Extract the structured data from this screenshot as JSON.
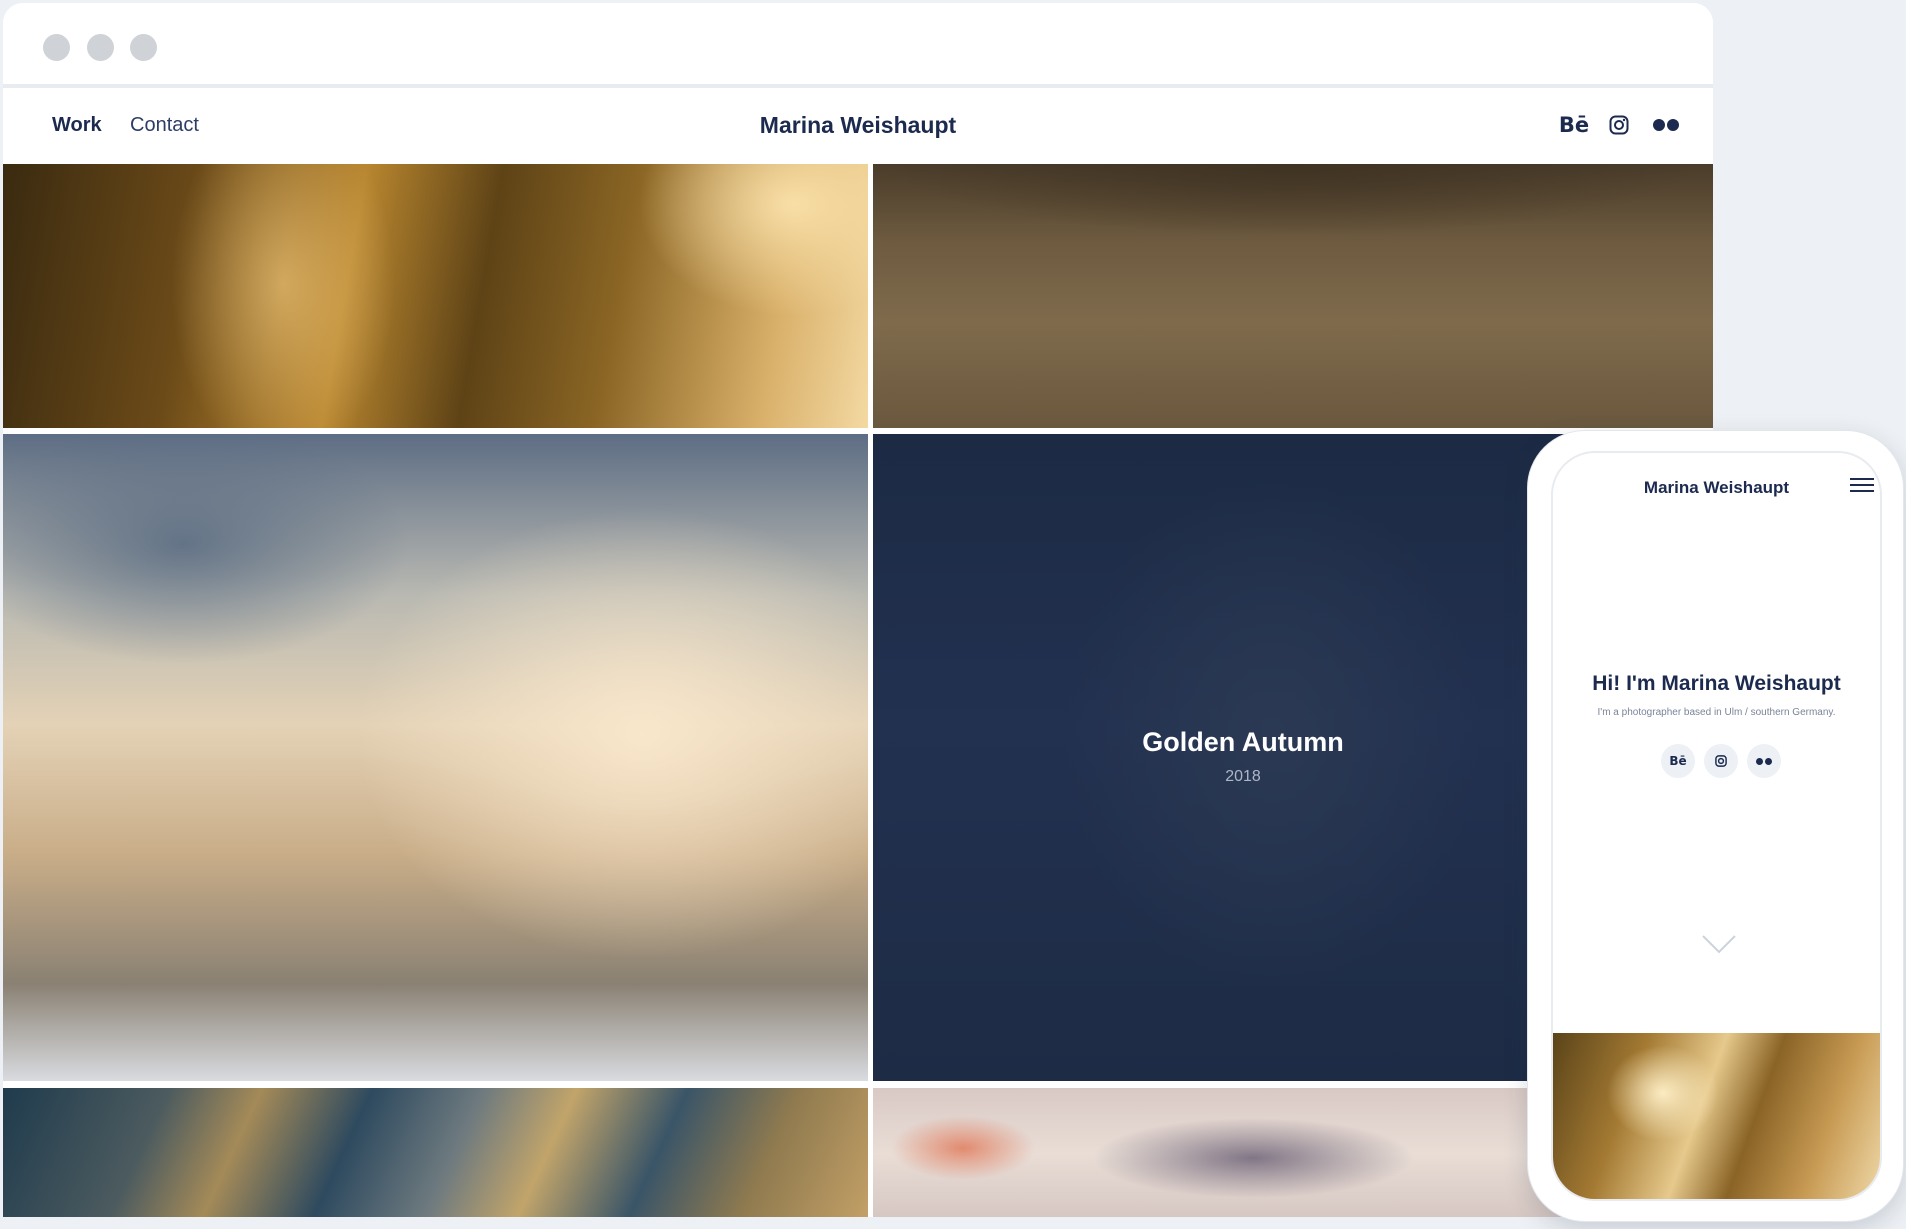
{
  "desktop": {
    "nav": {
      "work_label": "Work",
      "contact_label": "Contact"
    },
    "site_title": "Marina Weishaupt",
    "social": {
      "behance_label": "Bē"
    },
    "featured": {
      "title": "Golden Autumn",
      "year": "2018"
    }
  },
  "mobile": {
    "site_title": "Marina Weishaupt",
    "hero_title": "Hi! I'm Marina Weishaupt",
    "hero_subtitle": "I'm a photographer based in Ulm / southern Germany.",
    "behance_label": "Bē"
  },
  "icons": {
    "behance": "behance-icon",
    "instagram": "instagram-icon",
    "flickr": "flickr-icon",
    "menu": "hamburger-menu-icon",
    "scroll_down": "chevron-down-icon"
  },
  "colors": {
    "brand_navy": "#1b2a4e",
    "featured_overlay": "#1f2d48",
    "page_background": "#edf0f4"
  }
}
